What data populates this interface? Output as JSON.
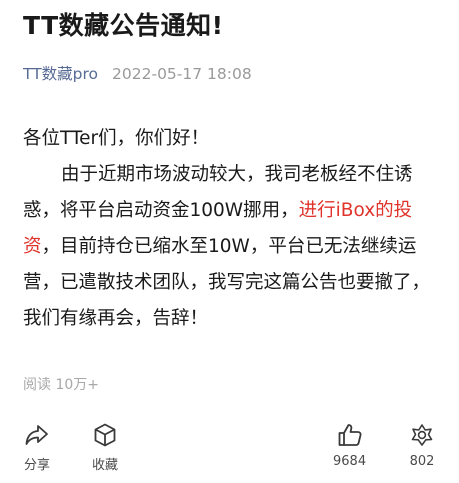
{
  "article": {
    "title": "TT数藏公告通知!",
    "account": "TT数藏pro",
    "date": "2022-05-17 18:08",
    "greeting": "各位TTer们，你们好！",
    "para_part1": "由于近期市场波动较大，我司老板经不住诱惑，将平台启动资金100W挪用，",
    "para_highlight": "进行iBox的投资",
    "para_part2": "，目前持仓已缩水至10W，平台已无法继续运营，已遣散技术团队，我写完这篇公告也要撤了，我们有缘再会，告辞！",
    "reads": "阅读 10万+"
  },
  "actions": {
    "share_label": "分享",
    "favorite_label": "收藏",
    "like_count": "9684",
    "wow_count": "802"
  },
  "colors": {
    "highlight": "#e0332c",
    "account": "#576b95"
  },
  "icons": {
    "share": "share-arrow-icon",
    "favorite": "cube-icon",
    "like": "thumbs-up-icon",
    "wow": "flower-icon"
  }
}
